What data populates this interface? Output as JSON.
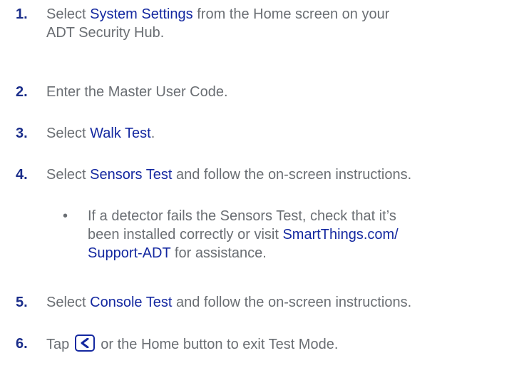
{
  "steps": [
    {
      "number": "1.",
      "line1_pre": "Select ",
      "line1_em": "System Settings",
      "line1_post": " from the Home screen on your",
      "line2": "ADT Security Hub."
    },
    {
      "number": "2.",
      "text": "Enter the Master User Code."
    },
    {
      "number": "3.",
      "pre": "Select ",
      "em": "Walk Test",
      "post": "."
    },
    {
      "number": "4.",
      "pre": "Select ",
      "em": "Sensors Test",
      "post": " and follow the on-screen instructions."
    },
    {
      "number": "5.",
      "pre": "Select ",
      "em": "Console Test",
      "post": " and follow the on-screen instructions."
    },
    {
      "number": "6.",
      "pre": "Tap",
      "icon": "back-chevron-icon",
      "post": "or the Home button to exit Test Mode."
    }
  ],
  "subbullet": {
    "bullet": "•",
    "line1": "If a detector fails the Sensors Test, check that it’s",
    "line2_pre": "been installed correctly or visit ",
    "line2_em": "SmartThings.com/",
    "line3_em": "Support-ADT",
    "line3_post": " for assistance."
  },
  "colors": {
    "body_text": "#6a6e73",
    "emphasis": "#1428a0",
    "number": "#1a2d8a"
  }
}
